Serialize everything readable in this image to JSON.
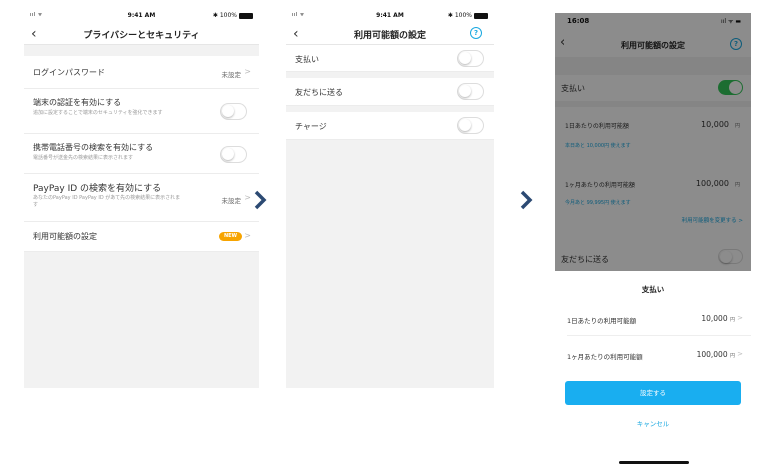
{
  "colors": {
    "accent": "#19a8e0",
    "badge": "#f7a400",
    "toggle_on": "#34c759",
    "chevron": "#2c4a73"
  },
  "screen1": {
    "status": {
      "signal": "ııl ᯤ",
      "time": "9:41 AM",
      "battery": "✱ 100%"
    },
    "nav": {
      "back": "‹",
      "title": "プライバシーとセキュリティ"
    },
    "rows": [
      {
        "label": "ログインパスワード",
        "value": "未設定",
        "chevron": ">"
      },
      {
        "label": "端末の認証を有効にする",
        "sub": "追加に設定することで端末のセキュリティを強化できます",
        "toggle": "off"
      },
      {
        "label": "携帯電話番号の検索を有効にする",
        "sub": "電話番号が送金先の検索結果に表示されます",
        "toggle": "off"
      },
      {
        "label": "PayPay ID の検索を有効にする",
        "sub": "あなたのPayPay ID PayPay ID があて先の検索結果に表示されます",
        "value": "未設定",
        "chevron": ">"
      },
      {
        "label": "利用可能額の設定",
        "badge": "NEW",
        "chevron": ">"
      }
    ]
  },
  "screen2": {
    "status": {
      "signal": "ııl ᯤ",
      "time": "9:41 AM",
      "battery": "✱ 100%"
    },
    "nav": {
      "back": "‹",
      "title": "利用可能額の設定",
      "help": "?"
    },
    "rows": [
      {
        "label": "支払い",
        "toggle": "off"
      },
      {
        "label": "友だちに送る",
        "toggle": "off"
      },
      {
        "label": "チャージ",
        "toggle": "off"
      }
    ]
  },
  "arrows": [
    "chevron-right",
    "chevron-right"
  ],
  "screen3": {
    "status": {
      "time": "16:08",
      "icons": "ııl ᯤ ▬"
    },
    "nav": {
      "back": "‹",
      "title": "利用可能額の設定",
      "help": "?"
    },
    "payment_row": {
      "label": "支払い",
      "toggle": "on"
    },
    "daily": {
      "label": "1日あたりの利用可能額",
      "value": "10,000",
      "unit": "円",
      "remaining": "本日あと 10,000円 使えます"
    },
    "monthly": {
      "label": "1ヶ月あたりの利用可能額",
      "value": "100,000",
      "unit": "円",
      "remaining": "今月あと 99,995円 使えます"
    },
    "change_link": "利用可能額を変更する >",
    "friends_row": {
      "label": "友だちに送る"
    },
    "sheet": {
      "title": "支払い",
      "rows": [
        {
          "label": "1日あたりの利用可能額",
          "value": "10,000",
          "unit": "円",
          "chevron": ">"
        },
        {
          "label": "1ヶ月あたりの利用可能額",
          "value": "100,000",
          "unit": "円",
          "chevron": ">"
        }
      ],
      "confirm": "設定する",
      "cancel": "キャンセル"
    }
  }
}
